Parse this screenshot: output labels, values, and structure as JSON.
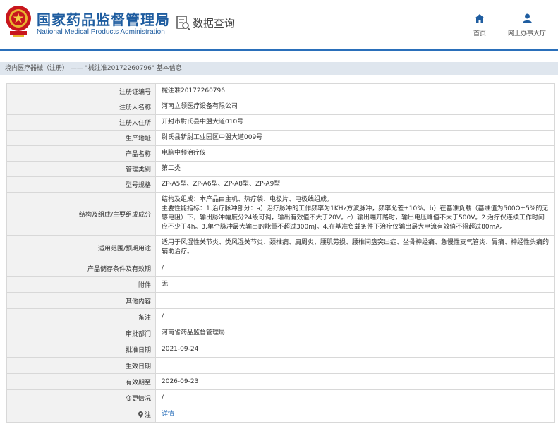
{
  "header": {
    "title": "国家药品监督管理局",
    "subtitle": "National Medical Products Administration",
    "query_title": "数据查询",
    "nav": [
      {
        "label": "首页",
        "icon": "home-icon"
      },
      {
        "label": "网上办事大厅",
        "icon": "user-icon"
      }
    ]
  },
  "breadcrumb": {
    "section": "境内医疗器械（注册）",
    "separator": " —— ",
    "current": "\"械注准20172260796\" 基本信息"
  },
  "details": [
    {
      "label": "注册证编号",
      "value": "械注准20172260796"
    },
    {
      "label": "注册人名称",
      "value": "河南立领医疗设备有限公司"
    },
    {
      "label": "注册人住所",
      "value": "开封市尉氏县中盟大道010号"
    },
    {
      "label": "生产地址",
      "value": "尉氏县新尉工业园区中盟大道009号"
    },
    {
      "label": "产品名称",
      "value": "电脑中频治疗仪"
    },
    {
      "label": "管理类别",
      "value": "第二类"
    },
    {
      "label": "型号规格",
      "value": "ZP-A5型、ZP-A6型、ZP-A8型、ZP-A9型"
    },
    {
      "label": "结构及组成/主要组成成分",
      "value": "结构及组成：本产品由主机、热疗袋、电极片、电极线组成。\n主要性能指标：1.治疗脉冲部分：a）治疗脉冲的工作频率为1KHz方波脉冲，频率允差±10%。b）在基准负载（基准值为500Ω±5%的无感电阻）下，输出脉冲幅度分24级可调，输出有效值不大于20V。c）输出端开路时，输出电压峰值不大于500V。2.治疗仪连续工作时间应不少于4h。3.单个脉冲最大输出的能量不超过300mJ。4.在基准负载条件下治疗仪输出最大电流有效值不得超过80mA。"
    },
    {
      "label": "适用范围/预期用途",
      "value": "适用于风湿性关节炎、类风湿关节炎、颈椎病、肩周炎、腰肌劳损、腰椎间盘突出症、坐骨神经痛、急慢性支气管炎、胃痛、神经性头痛的辅助治疗。"
    },
    {
      "label": "产品储存条件及有效期",
      "value": "/"
    },
    {
      "label": "附件",
      "value": "无"
    },
    {
      "label": "其他内容",
      "value": ""
    },
    {
      "label": "备注",
      "value": "/"
    },
    {
      "label": "审批部门",
      "value": "河南省药品监督管理局"
    },
    {
      "label": "批准日期",
      "value": "2021-09-24"
    },
    {
      "label": "生效日期",
      "value": ""
    },
    {
      "label": "有效期至",
      "value": "2026-09-23"
    },
    {
      "label": "变更情况",
      "value": "/"
    },
    {
      "label": "注",
      "value": "详情"
    }
  ]
}
